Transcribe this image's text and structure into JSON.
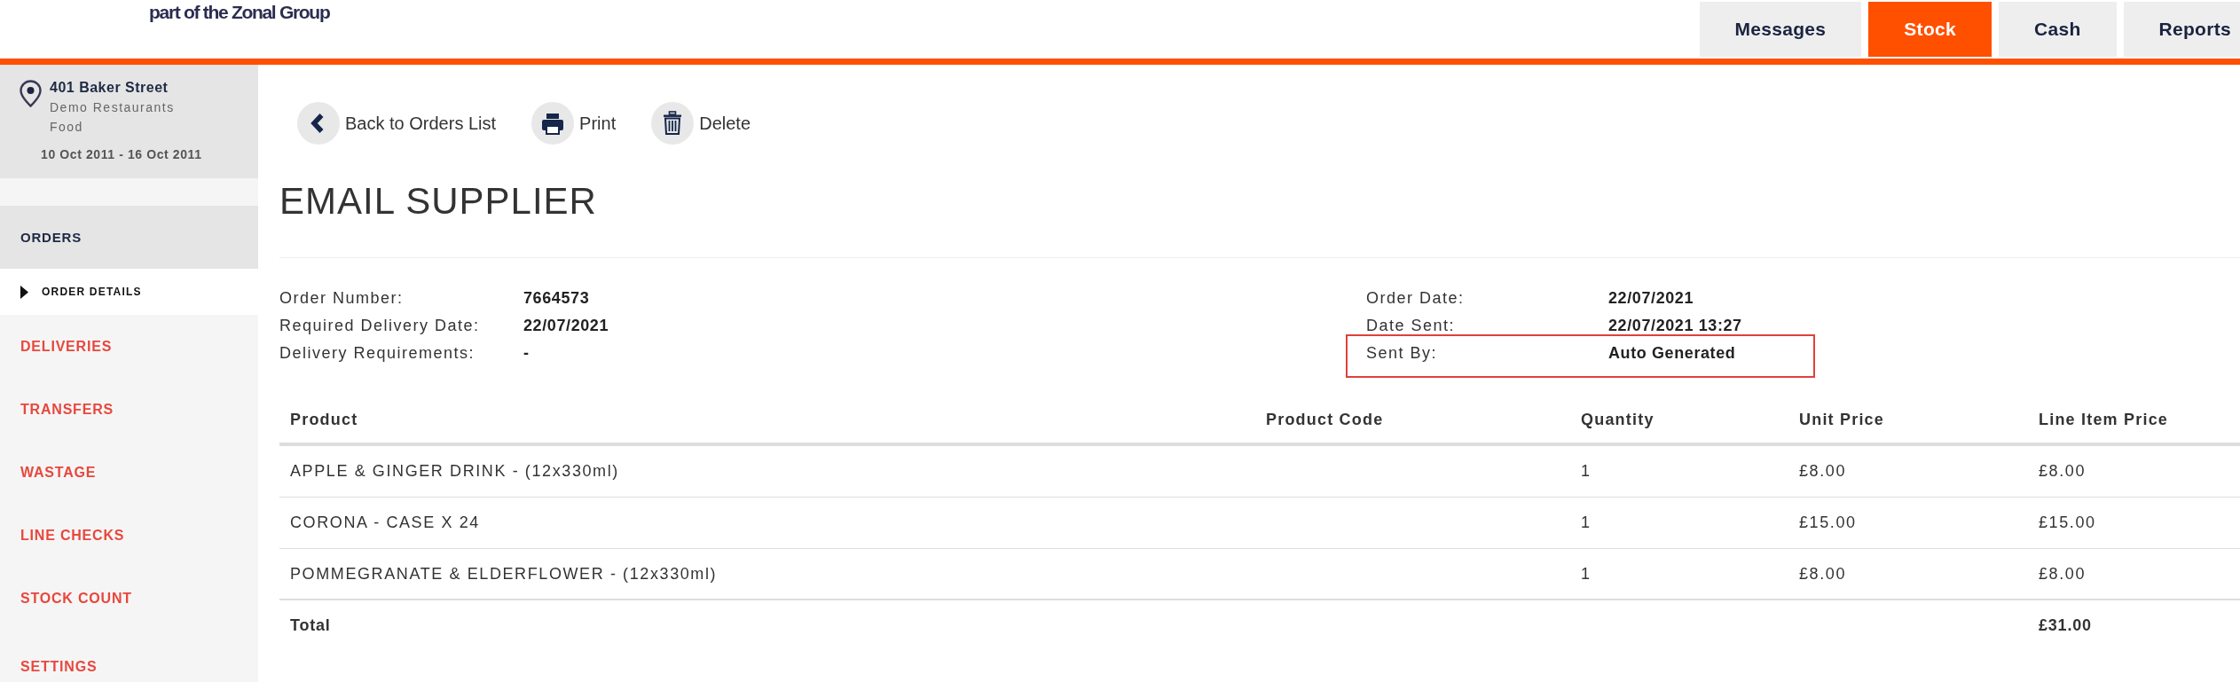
{
  "header": {
    "logo_text": "part of the Zonal Group"
  },
  "tabs": [
    {
      "label": "Messages",
      "selected": false
    },
    {
      "label": "Stock",
      "selected": true
    },
    {
      "label": "Cash",
      "selected": false
    },
    {
      "label": "Reports",
      "selected": false
    }
  ],
  "sidebar": {
    "location": {
      "name": "401 Baker Street",
      "company": "Demo Restaurants",
      "category": "Food",
      "date_range": "10 Oct 2011 - 16 Oct 2011"
    },
    "nav": [
      {
        "label": "ORDERS",
        "expanded": true,
        "children": [
          {
            "label": "ORDER DETAILS",
            "selected": true
          }
        ]
      },
      {
        "label": "DELIVERIES",
        "expanded": false
      },
      {
        "label": "TRANSFERS",
        "expanded": false
      },
      {
        "label": "WASTAGE",
        "expanded": false
      },
      {
        "label": "LINE CHECKS",
        "expanded": false
      },
      {
        "label": "STOCK COUNT",
        "expanded": false
      },
      {
        "label": "SETTINGS",
        "expanded": false
      }
    ]
  },
  "toolbar": [
    {
      "kind": "back",
      "label": "Back to Orders List"
    },
    {
      "kind": "print",
      "label": "Print"
    },
    {
      "kind": "delete",
      "label": "Delete"
    }
  ],
  "title": "EMAIL SUPPLIER",
  "order_details": {
    "left": [
      {
        "label": "Order Number:",
        "value": "7664573",
        "highlighted": false
      },
      {
        "label": "Required Delivery Date:",
        "value": "22/07/2021",
        "highlighted": false
      },
      {
        "label": "Delivery Requirements:",
        "value": "-",
        "highlighted": false
      }
    ],
    "right": [
      {
        "label": "Order Date:",
        "value": "22/07/2021",
        "highlighted": false
      },
      {
        "label": "Date Sent:",
        "value": "22/07/2021 13:27",
        "highlighted": false
      },
      {
        "label": "Sent By:",
        "value": "Auto Generated",
        "highlighted": true
      }
    ]
  },
  "table": {
    "columns": [
      "Product",
      "Product Code",
      "Quantity",
      "Unit Price",
      "Line Item Price"
    ],
    "rows": [
      {
        "product": "APPLE & GINGER DRINK - (12x330ml)",
        "quantity": "1",
        "unit_price": "£8.00",
        "line_item_price": "£8.00"
      },
      {
        "product": "CORONA - CASE X 24",
        "quantity": "1",
        "unit_price": "£15.00",
        "line_item_price": "£15.00"
      },
      {
        "product": "POMMEGRANATE & ELDERFLOWER - (12x330ml)",
        "quantity": "1",
        "unit_price": "£8.00",
        "line_item_price": "£8.00"
      }
    ],
    "total": {
      "label": "Total",
      "line_item_price": "£31.00"
    }
  }
}
